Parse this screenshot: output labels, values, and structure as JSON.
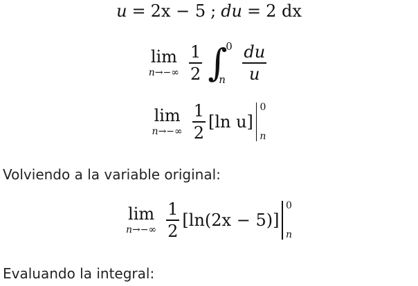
{
  "eq1": {
    "u": "u",
    "eq": "=",
    "rhs": "2x − 5",
    "sep": ";",
    "du": "du",
    "eq2": "=",
    "rhs2": "2 dx"
  },
  "eq2": {
    "lim": "lim",
    "lim_sub": "n→−∞",
    "frac_num": "1",
    "frac_den": "2",
    "int_upper": "0",
    "int_lower": "n",
    "integrand_num": "du",
    "integrand_den": "u"
  },
  "eq3": {
    "lim": "lim",
    "lim_sub": "n→−∞",
    "frac_num": "1",
    "frac_den": "2",
    "bracket_content": "[ln u]",
    "upper": "0",
    "lower": "n"
  },
  "text1": "Volviendo a la variable original:",
  "eq4": {
    "lim": "lim",
    "lim_sub": "n→−∞",
    "frac_num": "1",
    "frac_den": "2",
    "bracket_content": "[ln(2x − 5)]",
    "upper": "0",
    "lower": "n"
  },
  "text2": "Evaluando la integral:"
}
